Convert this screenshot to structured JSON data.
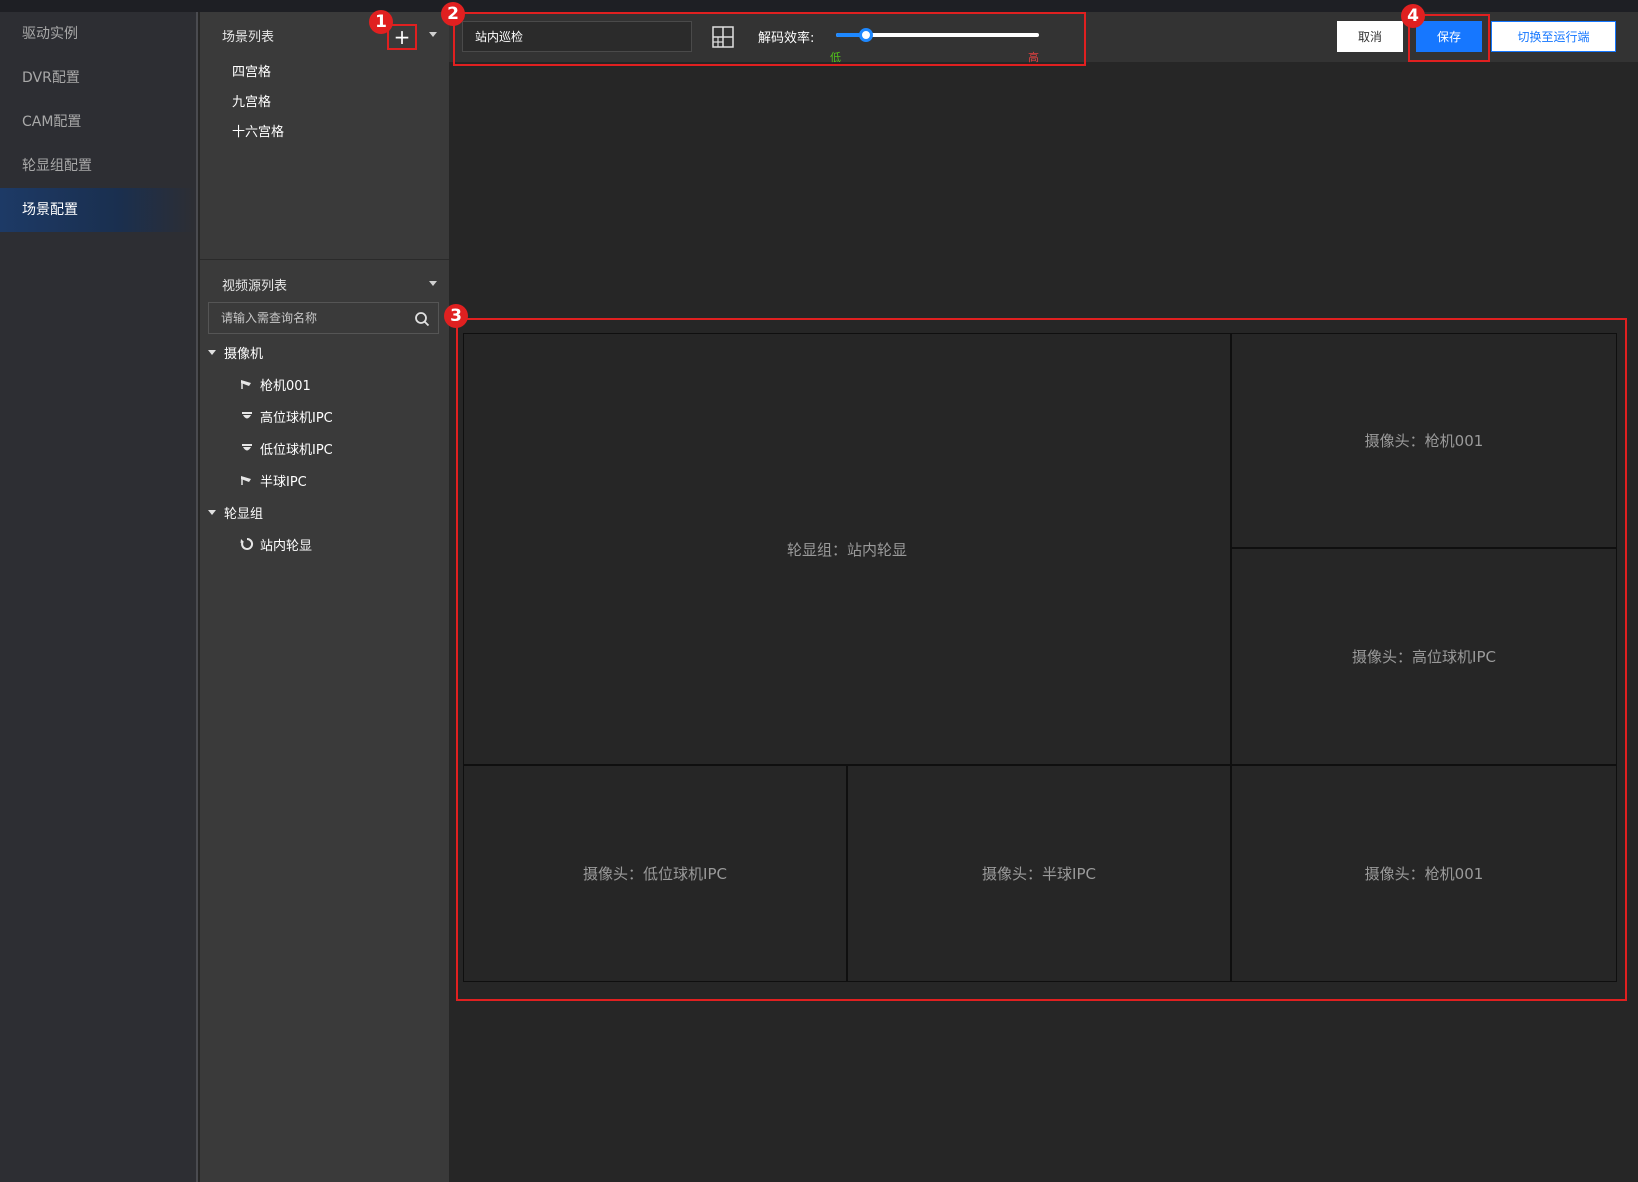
{
  "nav": {
    "items": [
      {
        "label": "驱动实例"
      },
      {
        "label": "DVR配置"
      },
      {
        "label": "CAM配置"
      },
      {
        "label": "轮显组配置"
      },
      {
        "label": "场景配置"
      }
    ],
    "active_index": 4
  },
  "scene_list": {
    "title": "场景列表",
    "add_label": "+",
    "items": [
      {
        "label": "四宫格"
      },
      {
        "label": "九宫格"
      },
      {
        "label": "十六宫格"
      }
    ]
  },
  "video_source": {
    "title": "视频源列表",
    "search_placeholder": "请输入需查询名称",
    "groups": [
      {
        "label": "摄像机",
        "items": [
          {
            "label": "枪机001",
            "icon": "bullet-camera-icon"
          },
          {
            "label": "高位球机IPC",
            "icon": "dome-camera-icon"
          },
          {
            "label": "低位球机IPC",
            "icon": "dome-camera-icon"
          },
          {
            "label": "半球IPC",
            "icon": "bullet-camera-icon"
          }
        ]
      },
      {
        "label": "轮显组",
        "items": [
          {
            "label": "站内轮显",
            "icon": "rotate-icon"
          }
        ]
      }
    ]
  },
  "toolbar": {
    "scene_name_value": "站内巡检",
    "decode_label": "解码效率:",
    "slider_low": "低",
    "slider_high": "高",
    "slider_value": 0.15,
    "cancel_label": "取消",
    "save_label": "保存",
    "switch_label": "切换至运行端"
  },
  "preview": {
    "main": "轮显组：站内轮显",
    "right_top": "摄像头：枪机001",
    "right_mid": "摄像头：高位球机IPC",
    "bottom_left": "摄像头：低位球机IPC",
    "bottom_mid": "摄像头：半球IPC",
    "bottom_right": "摄像头：枪机001"
  },
  "markers": {
    "m1": "1",
    "m2": "2",
    "m3": "3",
    "m4": "4"
  },
  "colors": {
    "accent": "#1677ff",
    "highlight": "#e02020",
    "low": "#52c41a",
    "high": "#e04040"
  }
}
